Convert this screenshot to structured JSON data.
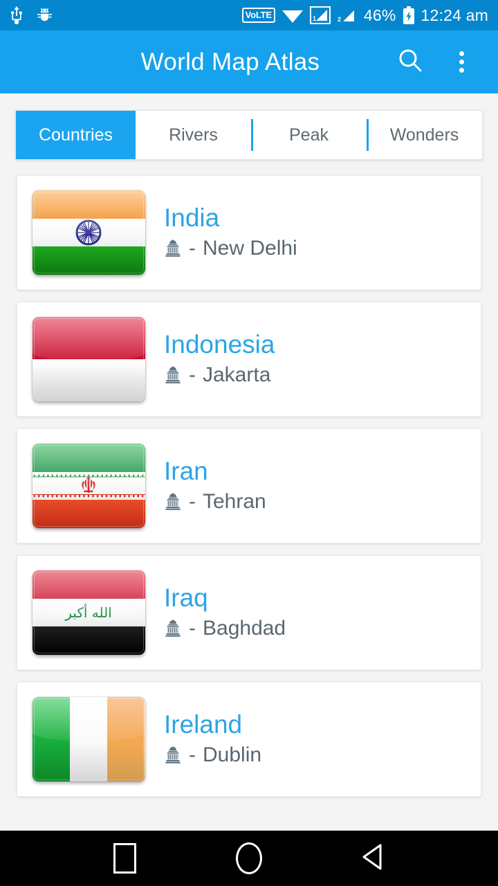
{
  "status_bar": {
    "background": "#0487cf",
    "left_icons": [
      "usb-icon",
      "android-debug-bug-icon"
    ],
    "volte_label": "VoLTE",
    "right_icons": [
      "wifi-icon",
      "signal-sim1-icon",
      "signal-sim2-icon"
    ],
    "sim1_label": "1",
    "sim2_label": "2",
    "battery_percent": "46%",
    "battery_icon": "battery-charging-icon",
    "time": "12:24 am"
  },
  "app_bar": {
    "title": "World Map Atlas",
    "background": "#16a2ec",
    "search_icon": "search-icon",
    "overflow_icon": "overflow-menu-icon"
  },
  "tabs": {
    "active_index": 0,
    "items": [
      {
        "label": "Countries"
      },
      {
        "label": "Rivers"
      },
      {
        "label": "Peak"
      },
      {
        "label": "Wonders"
      }
    ]
  },
  "list": {
    "separator": "-",
    "capital_icon": "capitol-building-icon",
    "items": [
      {
        "country": "India",
        "capital": "New Delhi",
        "flag_name": "flag-india",
        "flag": {
          "orientation": "horizontal",
          "colors": [
            "#f79433",
            "#ffffff",
            "#12a014"
          ],
          "emblem": "ashoka-chakra"
        }
      },
      {
        "country": "Indonesia",
        "capital": "Jakarta",
        "flag_name": "flag-indonesia",
        "flag": {
          "orientation": "horizontal",
          "colors": [
            "#d91e41",
            "#fdfdfd"
          ],
          "emblem": "none"
        }
      },
      {
        "country": "Iran",
        "capital": "Tehran",
        "flag_name": "flag-iran",
        "flag": {
          "orientation": "horizontal",
          "colors": [
            "#22a04a",
            "#ffffff",
            "#ee3b25"
          ],
          "emblem": "iran-emblem"
        }
      },
      {
        "country": "Iraq",
        "capital": "Baghdad",
        "flag_name": "flag-iraq",
        "flag": {
          "orientation": "horizontal",
          "colors": [
            "#d5213c",
            "#ffffff",
            "#141414"
          ],
          "emblem": "takbir-script",
          "emblem_text": "الله أكبر",
          "emblem_color": "#1e8c3e"
        }
      },
      {
        "country": "Ireland",
        "capital": "Dublin",
        "flag_name": "flag-ireland",
        "flag": {
          "orientation": "vertical",
          "colors": [
            "#11b33d",
            "#ffffff",
            "#f4913b"
          ],
          "emblem": "none"
        }
      }
    ]
  },
  "nav_bar": {
    "background": "#000000",
    "buttons": [
      {
        "icon": "recents-square-icon"
      },
      {
        "icon": "home-circle-icon"
      },
      {
        "icon": "back-triangle-icon"
      }
    ]
  },
  "colors": {
    "accent": "#1ba4ef",
    "country_text": "#2ba5e4",
    "capital_text": "#58676f",
    "page_bg": "#f4f4f4"
  }
}
